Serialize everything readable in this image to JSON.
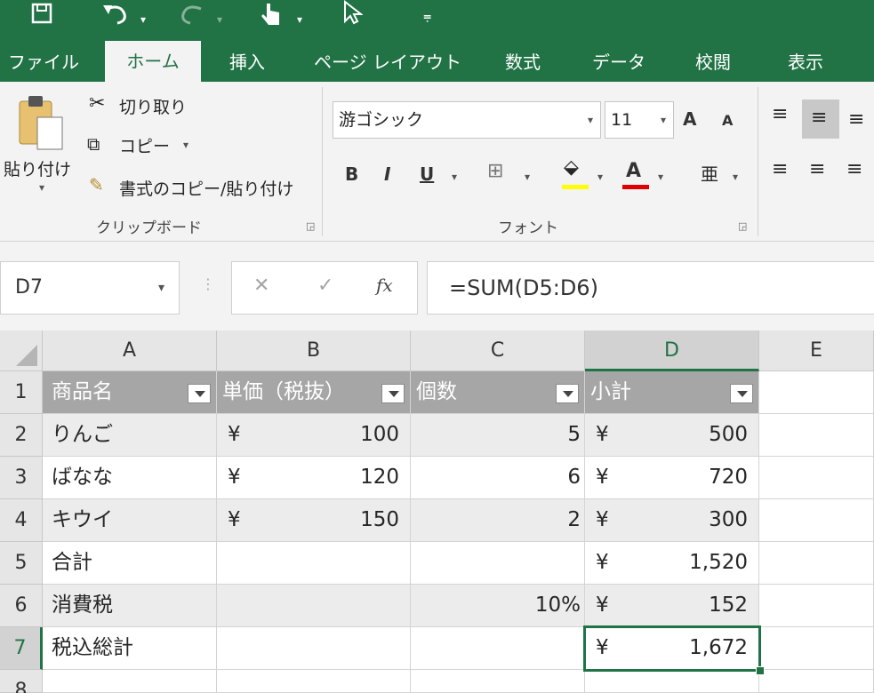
{
  "colors": {
    "accent": "#217346",
    "table_header": "#a6a6a6",
    "band": "#ececec"
  },
  "quick_access": {
    "save_icon": "save-icon",
    "undo_icon": "undo-icon",
    "redo_icon": "redo-icon",
    "touch_icon": "touch-mode-icon",
    "pointer_icon": "pointer-icon",
    "customize_icon": "customize-icon"
  },
  "tabs": [
    "ファイル",
    "ホーム",
    "挿入",
    "ページ レイアウト",
    "数式",
    "データ",
    "校閲",
    "表示"
  ],
  "ribbon": {
    "clipboard": {
      "paste": "貼り付け",
      "cut": "切り取り",
      "copy": "コピー",
      "format_painter": "書式のコピー/貼り付け",
      "group_label": "クリップボード"
    },
    "font": {
      "font_name": "游ゴシック",
      "font_size": "11",
      "bold": "B",
      "italic": "I",
      "underline": "U",
      "grow": "A",
      "shrink": "A",
      "font_color_letter": "A",
      "phonetic": "亜",
      "group_label": "フォント"
    }
  },
  "formula_bar": {
    "name_box": "D7",
    "cancel": "✕",
    "enter": "✓",
    "fx": "fx",
    "formula": "=SUM(D5:D6)"
  },
  "grid": {
    "columns": [
      "A",
      "B",
      "C",
      "D",
      "E"
    ],
    "rows": [
      "1",
      "2",
      "3",
      "4",
      "5",
      "6",
      "7",
      "8"
    ],
    "header": [
      "商品名",
      "単価（税抜）",
      "個数",
      "小計"
    ],
    "items": [
      {
        "name": "りんご",
        "yen": "¥",
        "price": "100",
        "qty": "5",
        "sub_yen": "¥",
        "subtotal": "500"
      },
      {
        "name": "ばなな",
        "yen": "¥",
        "price": "120",
        "qty": "6",
        "sub_yen": "¥",
        "subtotal": "720"
      },
      {
        "name": "キウイ",
        "yen": "¥",
        "price": "150",
        "qty": "2",
        "sub_yen": "¥",
        "subtotal": "300"
      }
    ],
    "total": {
      "label": "合計",
      "yen": "¥",
      "value": "1,520"
    },
    "tax": {
      "label": "消費税",
      "rate": "10%",
      "yen": "¥",
      "value": "152"
    },
    "grand": {
      "label": "税込総計",
      "yen": "¥",
      "value": "1,672"
    }
  }
}
